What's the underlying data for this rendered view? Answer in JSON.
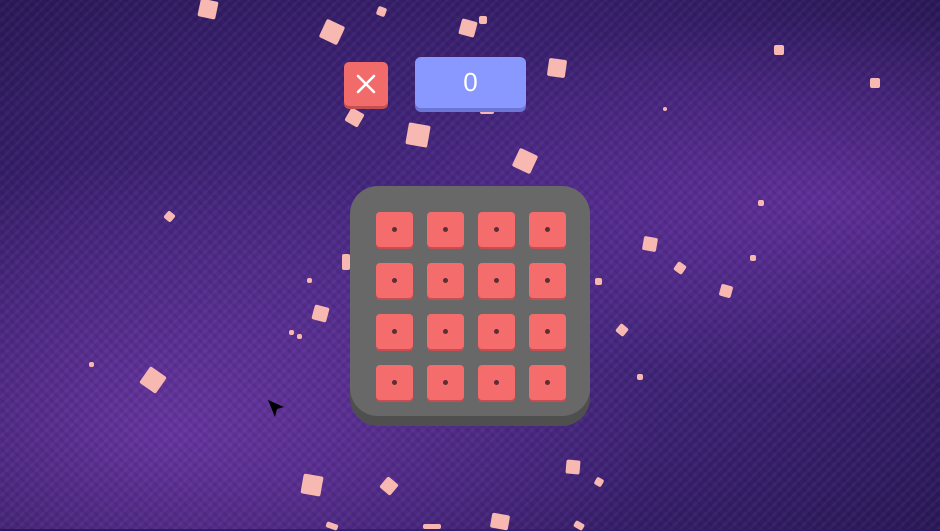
{
  "game": {
    "score": "0",
    "board": {
      "rows": 4,
      "cols": 4
    }
  },
  "icons": {
    "close": "close-icon",
    "cursor": "mouse-pointer-icon"
  },
  "colors": {
    "background": "#3a2070",
    "confetti": "#f7b8b2",
    "close_button": "#f26b6b",
    "score_box": "#8898ff",
    "board": "#686868",
    "tile": "#f56c6c"
  }
}
